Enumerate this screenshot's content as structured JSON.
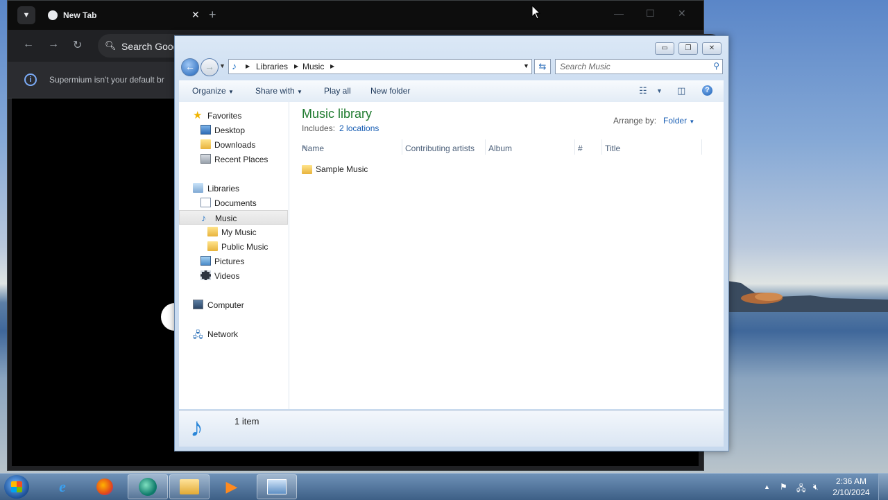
{
  "chrome": {
    "tab_title": "New Tab",
    "omnibox_text": "Search Goog",
    "infobar_message": "Supermium isn't your default br"
  },
  "explorer": {
    "breadcrumb": [
      "Libraries",
      "Music"
    ],
    "search_placeholder": "Search Music",
    "commands": {
      "organize": "Organize",
      "share_with": "Share with",
      "play_all": "Play all",
      "new_folder": "New folder"
    },
    "nav": {
      "favorites": "Favorites",
      "desktop": "Desktop",
      "downloads": "Downloads",
      "recent_places": "Recent Places",
      "libraries": "Libraries",
      "documents": "Documents",
      "music": "Music",
      "my_music": "My Music",
      "public_music": "Public Music",
      "pictures": "Pictures",
      "videos": "Videos",
      "computer": "Computer",
      "network": "Network"
    },
    "library_title": "Music library",
    "includes_label": "Includes:",
    "includes_link": "2 locations",
    "arrange_label": "Arrange by:",
    "arrange_value": "Folder",
    "columns": [
      "Name",
      "Contributing artists",
      "Album",
      "#",
      "Title"
    ],
    "items": [
      "Sample Music"
    ],
    "status": "1 item"
  },
  "taskbar": {
    "time": "2:36 AM",
    "date": "2/10/2024"
  }
}
